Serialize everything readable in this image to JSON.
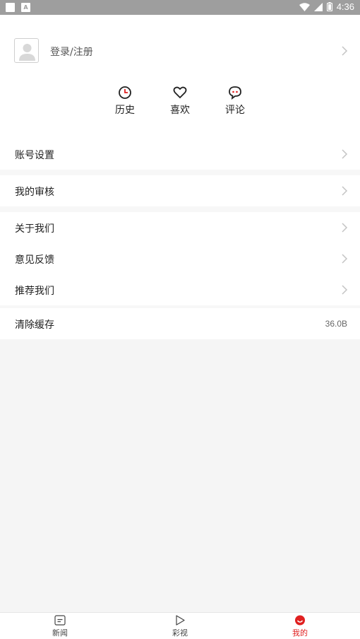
{
  "status_bar": {
    "time": "4:36"
  },
  "profile": {
    "login_label": "登录/注册"
  },
  "quick_actions": [
    {
      "label": "历史",
      "icon": "clock-icon"
    },
    {
      "label": "喜欢",
      "icon": "heart-icon"
    },
    {
      "label": "评论",
      "icon": "comment-icon"
    }
  ],
  "settings": {
    "account": "账号设置",
    "review": "我的审核",
    "about": "关于我们",
    "feedback": "意见反馈",
    "recommend": "推荐我们",
    "clear_cache": "清除缓存",
    "cache_size": "36.0B"
  },
  "bottom_nav": [
    {
      "label": "新闻",
      "icon": "news-icon"
    },
    {
      "label": "彩视",
      "icon": "play-icon"
    },
    {
      "label": "我的",
      "icon": "me-icon",
      "active": true
    }
  ],
  "colors": {
    "accent": "#e02020",
    "status_bar": "#9e9e9e",
    "background": "#f5f5f5"
  }
}
